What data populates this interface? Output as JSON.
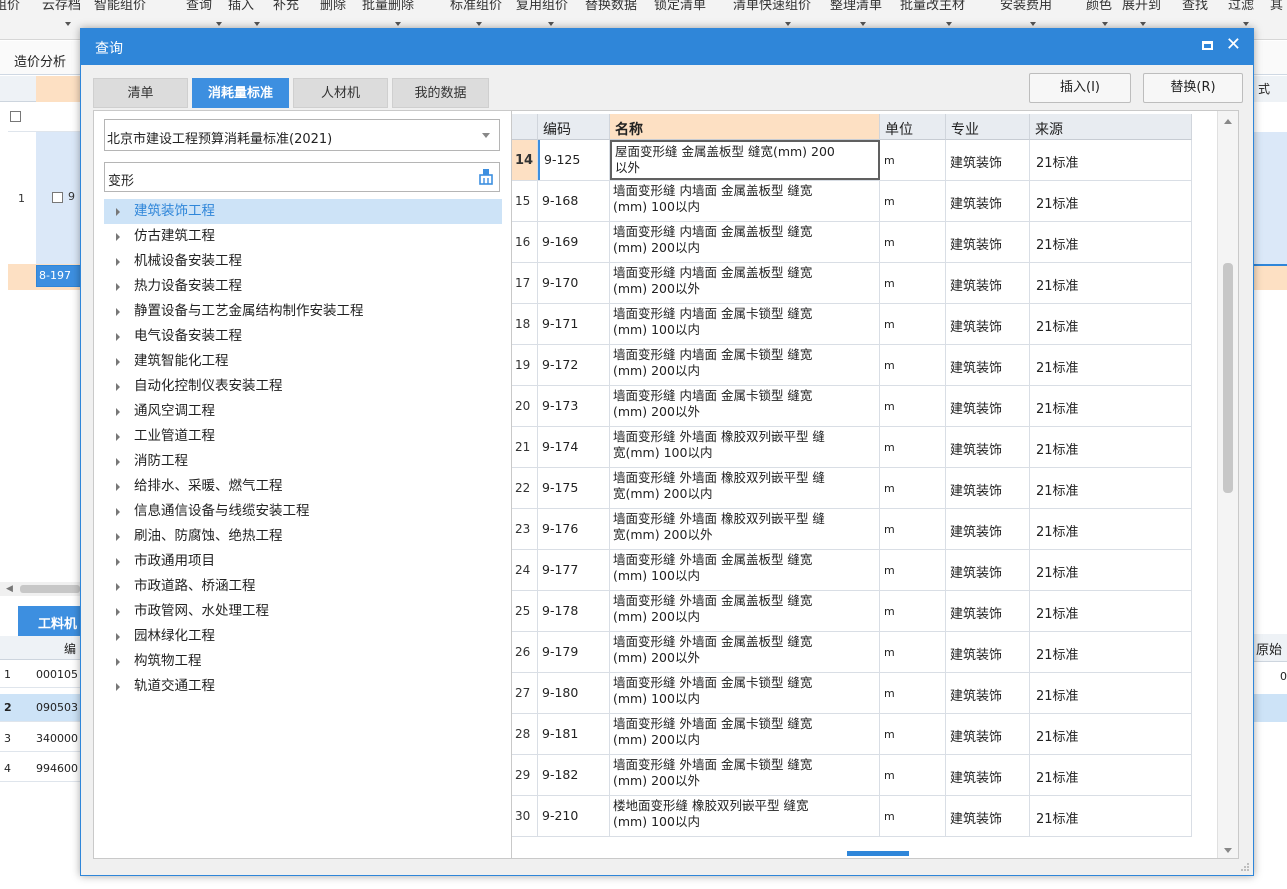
{
  "toolbar": {
    "items": [
      "组价",
      "云存档",
      "智能组价",
      "查询",
      "插入",
      "补充",
      "删除",
      "批量删除",
      "标准组价",
      "复用组价",
      "替换数据",
      "锁定清单",
      "清单快速组价",
      "整理清单",
      "批量改主材",
      "安装费用",
      "颜色",
      "展开到",
      "查找",
      "过滤",
      "其"
    ]
  },
  "background": {
    "tab_label": "造价分析",
    "left_row_num": "1",
    "left_row_code": "9",
    "left_row_code2": "8-197",
    "bottom_tab": "工料机",
    "bottom_header": "编",
    "bottom_rows": [
      {
        "n": "1",
        "code": "000105"
      },
      {
        "n": "2",
        "code": "090503"
      },
      {
        "n": "3",
        "code": "340000"
      },
      {
        "n": "4",
        "code": "994600"
      }
    ],
    "right_header": "式",
    "right_header2": "原始",
    "right_val": "0"
  },
  "dialog": {
    "title": "查询",
    "tabs": [
      "清单",
      "消耗量标准",
      "人材机",
      "我的数据"
    ],
    "insert_button": "插入(I)",
    "replace_button": "替换(R)",
    "standard_select": "北京市建设工程预算消耗量标准(2021)",
    "search_value": "变形",
    "tree": [
      "建筑装饰工程",
      "仿古建筑工程",
      "机械设备安装工程",
      "热力设备安装工程",
      "静置设备与工艺金属结构制作安装工程",
      "电气设备安装工程",
      "建筑智能化工程",
      "自动化控制仪表安装工程",
      "通风空调工程",
      "工业管道工程",
      "消防工程",
      "给排水、采暖、燃气工程",
      "信息通信设备与线缆安装工程",
      "刷油、防腐蚀、绝热工程",
      "市政通用项目",
      "市政道路、桥涵工程",
      "市政管网、水处理工程",
      "园林绿化工程",
      "构筑物工程",
      "轨道交通工程"
    ],
    "grid": {
      "headers": {
        "code": "编码",
        "name": "名称",
        "unit": "单位",
        "spec": "专业",
        "src": "来源"
      },
      "rows": [
        {
          "n": "14",
          "code": "9-125",
          "l1": "屋面变形缝 金属盖板型 缝宽(mm) 200",
          "l2": "以外",
          "unit": "m",
          "spec": "建筑装饰",
          "src": "21标准"
        },
        {
          "n": "15",
          "code": "9-168",
          "l1": "墙面变形缝 内墙面 金属盖板型 缝宽",
          "l2": "(mm) 100以内",
          "unit": "m",
          "spec": "建筑装饰",
          "src": "21标准"
        },
        {
          "n": "16",
          "code": "9-169",
          "l1": "墙面变形缝 内墙面 金属盖板型 缝宽",
          "l2": "(mm) 200以内",
          "unit": "m",
          "spec": "建筑装饰",
          "src": "21标准"
        },
        {
          "n": "17",
          "code": "9-170",
          "l1": "墙面变形缝 内墙面 金属盖板型 缝宽",
          "l2": "(mm) 200以外",
          "unit": "m",
          "spec": "建筑装饰",
          "src": "21标准"
        },
        {
          "n": "18",
          "code": "9-171",
          "l1": "墙面变形缝 内墙面 金属卡锁型 缝宽",
          "l2": "(mm) 100以内",
          "unit": "m",
          "spec": "建筑装饰",
          "src": "21标准"
        },
        {
          "n": "19",
          "code": "9-172",
          "l1": "墙面变形缝 内墙面 金属卡锁型 缝宽",
          "l2": "(mm) 200以内",
          "unit": "m",
          "spec": "建筑装饰",
          "src": "21标准"
        },
        {
          "n": "20",
          "code": "9-173",
          "l1": "墙面变形缝 内墙面 金属卡锁型 缝宽",
          "l2": "(mm) 200以外",
          "unit": "m",
          "spec": "建筑装饰",
          "src": "21标准"
        },
        {
          "n": "21",
          "code": "9-174",
          "l1": "墙面变形缝 外墙面 橡胶双列嵌平型 缝",
          "l2": "宽(mm) 100以内",
          "unit": "m",
          "spec": "建筑装饰",
          "src": "21标准"
        },
        {
          "n": "22",
          "code": "9-175",
          "l1": "墙面变形缝 外墙面 橡胶双列嵌平型 缝",
          "l2": "宽(mm) 200以内",
          "unit": "m",
          "spec": "建筑装饰",
          "src": "21标准"
        },
        {
          "n": "23",
          "code": "9-176",
          "l1": "墙面变形缝 外墙面 橡胶双列嵌平型 缝",
          "l2": "宽(mm) 200以外",
          "unit": "m",
          "spec": "建筑装饰",
          "src": "21标准"
        },
        {
          "n": "24",
          "code": "9-177",
          "l1": "墙面变形缝 外墙面 金属盖板型 缝宽",
          "l2": "(mm) 100以内",
          "unit": "m",
          "spec": "建筑装饰",
          "src": "21标准"
        },
        {
          "n": "25",
          "code": "9-178",
          "l1": "墙面变形缝 外墙面 金属盖板型 缝宽",
          "l2": "(mm) 200以内",
          "unit": "m",
          "spec": "建筑装饰",
          "src": "21标准"
        },
        {
          "n": "26",
          "code": "9-179",
          "l1": "墙面变形缝 外墙面 金属盖板型 缝宽",
          "l2": "(mm) 200以外",
          "unit": "m",
          "spec": "建筑装饰",
          "src": "21标准"
        },
        {
          "n": "27",
          "code": "9-180",
          "l1": "墙面变形缝 外墙面 金属卡锁型 缝宽",
          "l2": "(mm) 100以内",
          "unit": "m",
          "spec": "建筑装饰",
          "src": "21标准"
        },
        {
          "n": "28",
          "code": "9-181",
          "l1": "墙面变形缝 外墙面 金属卡锁型 缝宽",
          "l2": "(mm) 200以内",
          "unit": "m",
          "spec": "建筑装饰",
          "src": "21标准"
        },
        {
          "n": "29",
          "code": "9-182",
          "l1": "墙面变形缝 外墙面 金属卡锁型 缝宽",
          "l2": "(mm) 200以外",
          "unit": "m",
          "spec": "建筑装饰",
          "src": "21标准"
        },
        {
          "n": "30",
          "code": "9-210",
          "l1": "楼地面变形缝 橡胶双列嵌平型 缝宽",
          "l2": "(mm) 100以内",
          "unit": "m",
          "spec": "建筑装饰",
          "src": "21标准"
        }
      ]
    }
  },
  "colors": {
    "accent": "#2f86d9",
    "active_tab": "#3d8fe0",
    "header_highlight": "#fde0c3",
    "tree_selected": "#cde3f7"
  }
}
